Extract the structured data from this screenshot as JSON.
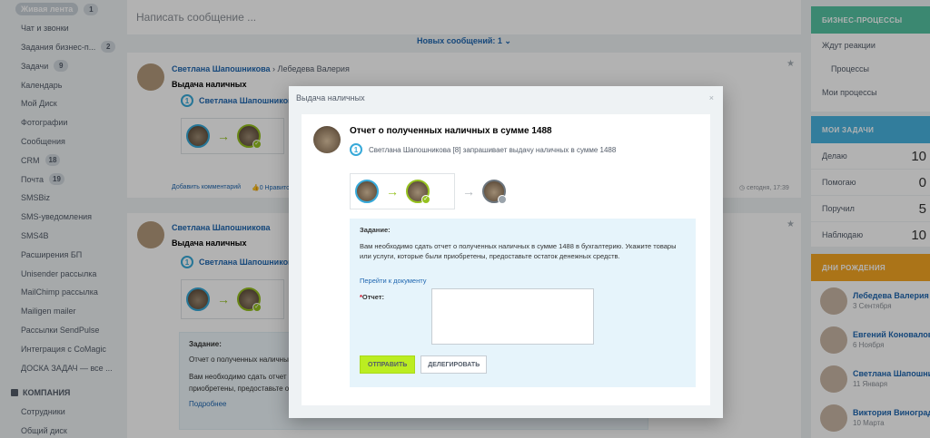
{
  "sidebar": {
    "items": [
      {
        "label": "Живая лента",
        "count": "1",
        "active": true
      },
      {
        "label": "Чат и звонки",
        "count": ""
      },
      {
        "label": "Задания бизнес-п...",
        "count": "2"
      },
      {
        "label": "Задачи",
        "count": "9"
      },
      {
        "label": "Календарь",
        "count": ""
      },
      {
        "label": "Мой Диск",
        "count": ""
      },
      {
        "label": "Фотографии",
        "count": ""
      },
      {
        "label": "Сообщения",
        "count": ""
      },
      {
        "label": "CRM",
        "count": "18"
      },
      {
        "label": "Почта",
        "count": "19"
      },
      {
        "label": "SMSBiz",
        "count": ""
      },
      {
        "label": "SMS-уведомления",
        "count": ""
      },
      {
        "label": "SMS4B",
        "count": ""
      },
      {
        "label": "Расширения БП",
        "count": ""
      },
      {
        "label": "Unisender рассылка",
        "count": ""
      },
      {
        "label": "MailChimp рассылка",
        "count": ""
      },
      {
        "label": "Mailigen mailer",
        "count": ""
      },
      {
        "label": "Рассылки SendPulse",
        "count": ""
      },
      {
        "label": "Интеграция с CoMagic",
        "count": ""
      },
      {
        "label": "ДОСКА ЗАДАЧ — все ...",
        "count": ""
      }
    ],
    "section_title": "КОМПАНИЯ",
    "section_items": [
      "Сотрудники",
      "Общий диск"
    ]
  },
  "feed": {
    "composer_placeholder": "Написать сообщение ...",
    "new_messages": "Новых сообщений: 1",
    "post1": {
      "author": "Светлана Шапошникова",
      "arrow": "›",
      "recipient": "Лебедева Валерия",
      "title": "Выдача наличных",
      "bp_author": "Светлана Шапошников",
      "comment_link": "Добавить комментарий",
      "like_link": "0 Нравится",
      "time": "сегодня, 17:39"
    },
    "post2": {
      "author": "Светлана Шапошникова",
      "title": "Выдача наличных",
      "bp_author": "Светлана Шапошников",
      "task_head": "Задание:",
      "task_line1": "Отчет о полученных наличных",
      "task_line2": "Вам необходимо сдать отчет о",
      "task_line3": "приобретены, предоставьте ост",
      "more_link": "Подробнее"
    }
  },
  "right": {
    "bp_title": "БИЗНЕС-ПРОЦЕССЫ",
    "bp_links": [
      "Ждут реакции",
      "Процессы",
      "Мои процессы"
    ],
    "tasks_title": "МОИ ЗАДАЧИ",
    "task_stats": [
      {
        "label": "Делаю",
        "value": "10"
      },
      {
        "label": "Помогаю",
        "value": "0"
      },
      {
        "label": "Поручил",
        "value": "5"
      },
      {
        "label": "Наблюдаю",
        "value": "10"
      }
    ],
    "bday_title": "ДНИ РОЖДЕНИЯ",
    "birthdays": [
      {
        "name": "Лебедева Валерия",
        "date": "3 Сентября"
      },
      {
        "name": "Евгений Коновалов",
        "date": "6 Ноября"
      },
      {
        "name": "Светлана Шапошни",
        "date": "11 Января"
      },
      {
        "name": "Виктория Виноград",
        "date": "10 Марта"
      }
    ]
  },
  "dialog": {
    "title": "Выдача наличных",
    "close": "×",
    "heading": "Отчет о полученных наличных в сумме 1488",
    "subline": "Светлана Шапошникова [8] запрашивает выдачу наличных в сумме 1488",
    "task_head": "Задание:",
    "task_text": "Вам необходимо сдать отчет о полученных наличных в сумме 1488 в бухгалтерию. Укажите товары или услуги, которые были приобретены, предоставьте остаток денежных средств.",
    "doc_link": "Перейти к документу",
    "required_mark": "*",
    "report_label": "Отчет:",
    "send_label": "ОТПРАВИТЬ",
    "delegate_label": "ДЕЛЕГИРОВАТЬ"
  }
}
